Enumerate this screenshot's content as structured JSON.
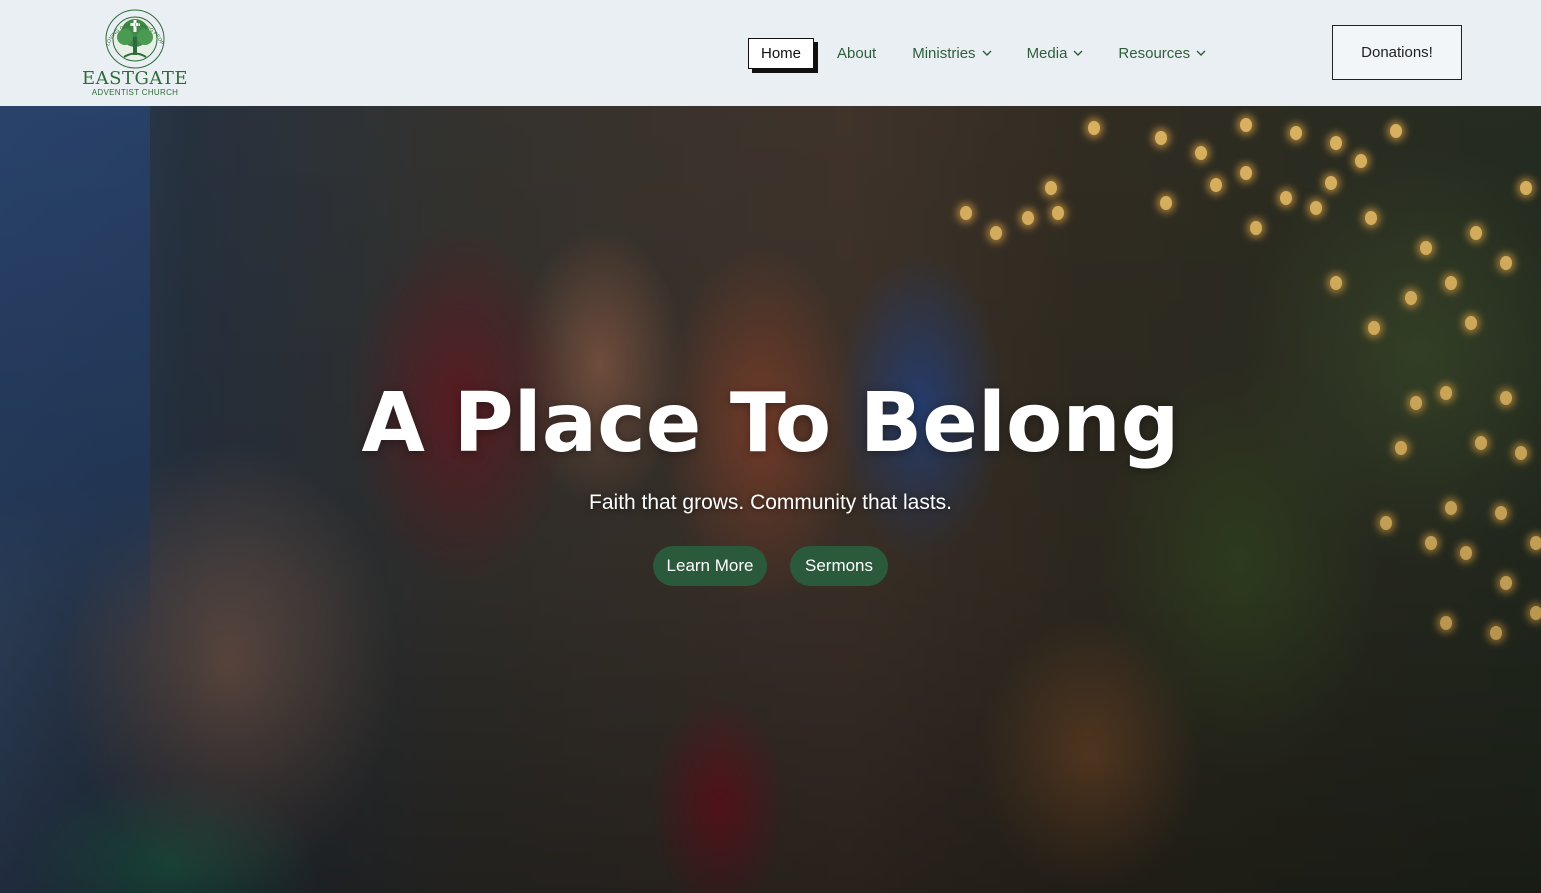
{
  "logo": {
    "name": "EASTGATE",
    "sub": "ADVENTIST CHURCH",
    "arc": "LOVING GOD, LOVING PEOPLE"
  },
  "nav": {
    "items": [
      {
        "label": "Home",
        "active": true
      },
      {
        "label": "About",
        "dropdown": false
      },
      {
        "label": "Ministries",
        "dropdown": true
      },
      {
        "label": "Media",
        "dropdown": true
      },
      {
        "label": "Resources",
        "dropdown": true
      }
    ]
  },
  "header": {
    "donate_label": "Donations!"
  },
  "hero": {
    "headline": "A Place To Belong",
    "tagline": "Faith that grows. Community that lasts.",
    "buttons": [
      {
        "label": "Learn More"
      },
      {
        "label": "Sermons"
      }
    ]
  },
  "colors": {
    "brand_green": "#2a5a3b",
    "header_bg": "#eaeff3",
    "nav_text": "#2f5e3b"
  }
}
